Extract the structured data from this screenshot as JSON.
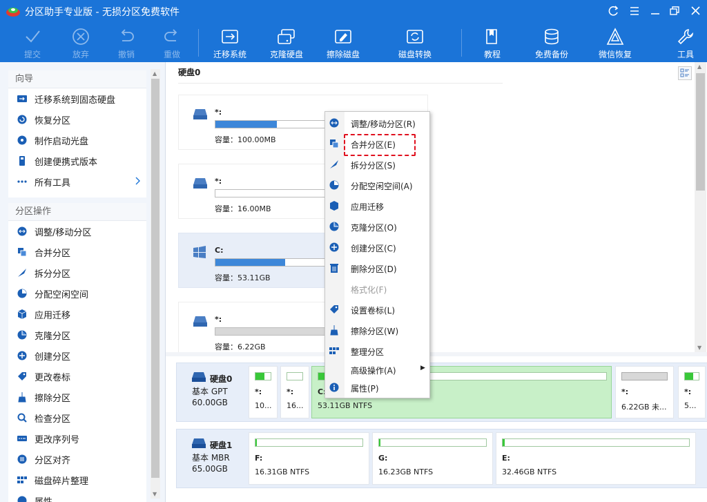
{
  "app": {
    "title": "分区助手专业版 - 无损分区免费软件"
  },
  "toolbar": {
    "commit": "提交",
    "discard": "放弃",
    "undo": "撤销",
    "redo": "重做",
    "migrate_os": "迁移系统",
    "clone_disk": "克隆硬盘",
    "wipe_disk": "擦除磁盘",
    "disk_convert": "磁盘转换",
    "tutorial": "教程",
    "free_backup": "免费备份",
    "wechat_recovery": "微信恢复",
    "tools": "工具"
  },
  "wizard": {
    "header": "向导",
    "items": [
      "迁移系统到固态硬盘",
      "恢复分区",
      "制作启动光盘",
      "创建便携式版本",
      "所有工具"
    ]
  },
  "ops": {
    "header": "分区操作",
    "items": [
      "调整/移动分区",
      "合并分区",
      "拆分分区",
      "分配空闲空间",
      "应用迁移",
      "克隆分区",
      "创建分区",
      "更改卷标",
      "擦除分区",
      "检查分区",
      "更改序列号",
      "分区对齐",
      "磁盘碎片整理",
      "属性"
    ]
  },
  "main": {
    "disk_title": "硬盘0",
    "partitions": [
      {
        "name": "*:",
        "capacity": "容量：100.00MB",
        "used": 0.3
      },
      {
        "name": "*:",
        "capacity": "容量：16.00MB",
        "used": 0.0
      },
      {
        "name": "C:",
        "capacity": "容量：53.11GB",
        "used": 0.34
      },
      {
        "name": "*:",
        "capacity": "容量：6.22GB",
        "used": 0.55
      }
    ]
  },
  "bottom": {
    "disk0": {
      "name": "硬盘0",
      "type": "基本 GPT",
      "size": "60.00GB",
      "blocks": [
        {
          "name": "*:",
          "info": "10..."
        },
        {
          "name": "*:",
          "info": "16..."
        },
        {
          "name": "C:",
          "info": "53.11GB NTFS"
        },
        {
          "name": "*:",
          "info": "6.22GB 未..."
        },
        {
          "name": "*:",
          "info": "5..."
        }
      ]
    },
    "disk1": {
      "name": "硬盘1",
      "type": "基本 MBR",
      "size": "65.00GB",
      "blocks": [
        {
          "name": "F:",
          "info": "16.31GB NTFS"
        },
        {
          "name": "G:",
          "info": "16.23GB NTFS"
        },
        {
          "name": "E:",
          "info": "32.46GB NTFS"
        }
      ]
    }
  },
  "context_menu": {
    "items": [
      "调整/移动分区(R)",
      "合并分区(E)",
      "拆分分区(S)",
      "分配空闲空间(A)",
      "应用迁移",
      "克隆分区(O)",
      "创建分区(C)",
      "删除分区(D)",
      "格式化(F)",
      "设置卷标(L)",
      "擦除分区(W)",
      "整理分区",
      "高级操作(A)",
      "属性(P)"
    ]
  },
  "colors": {
    "accent": "#1b74d8",
    "highlight": "#e0101e",
    "partition_fill": "#3d87d9",
    "selected_green": "#c8f0c8"
  }
}
